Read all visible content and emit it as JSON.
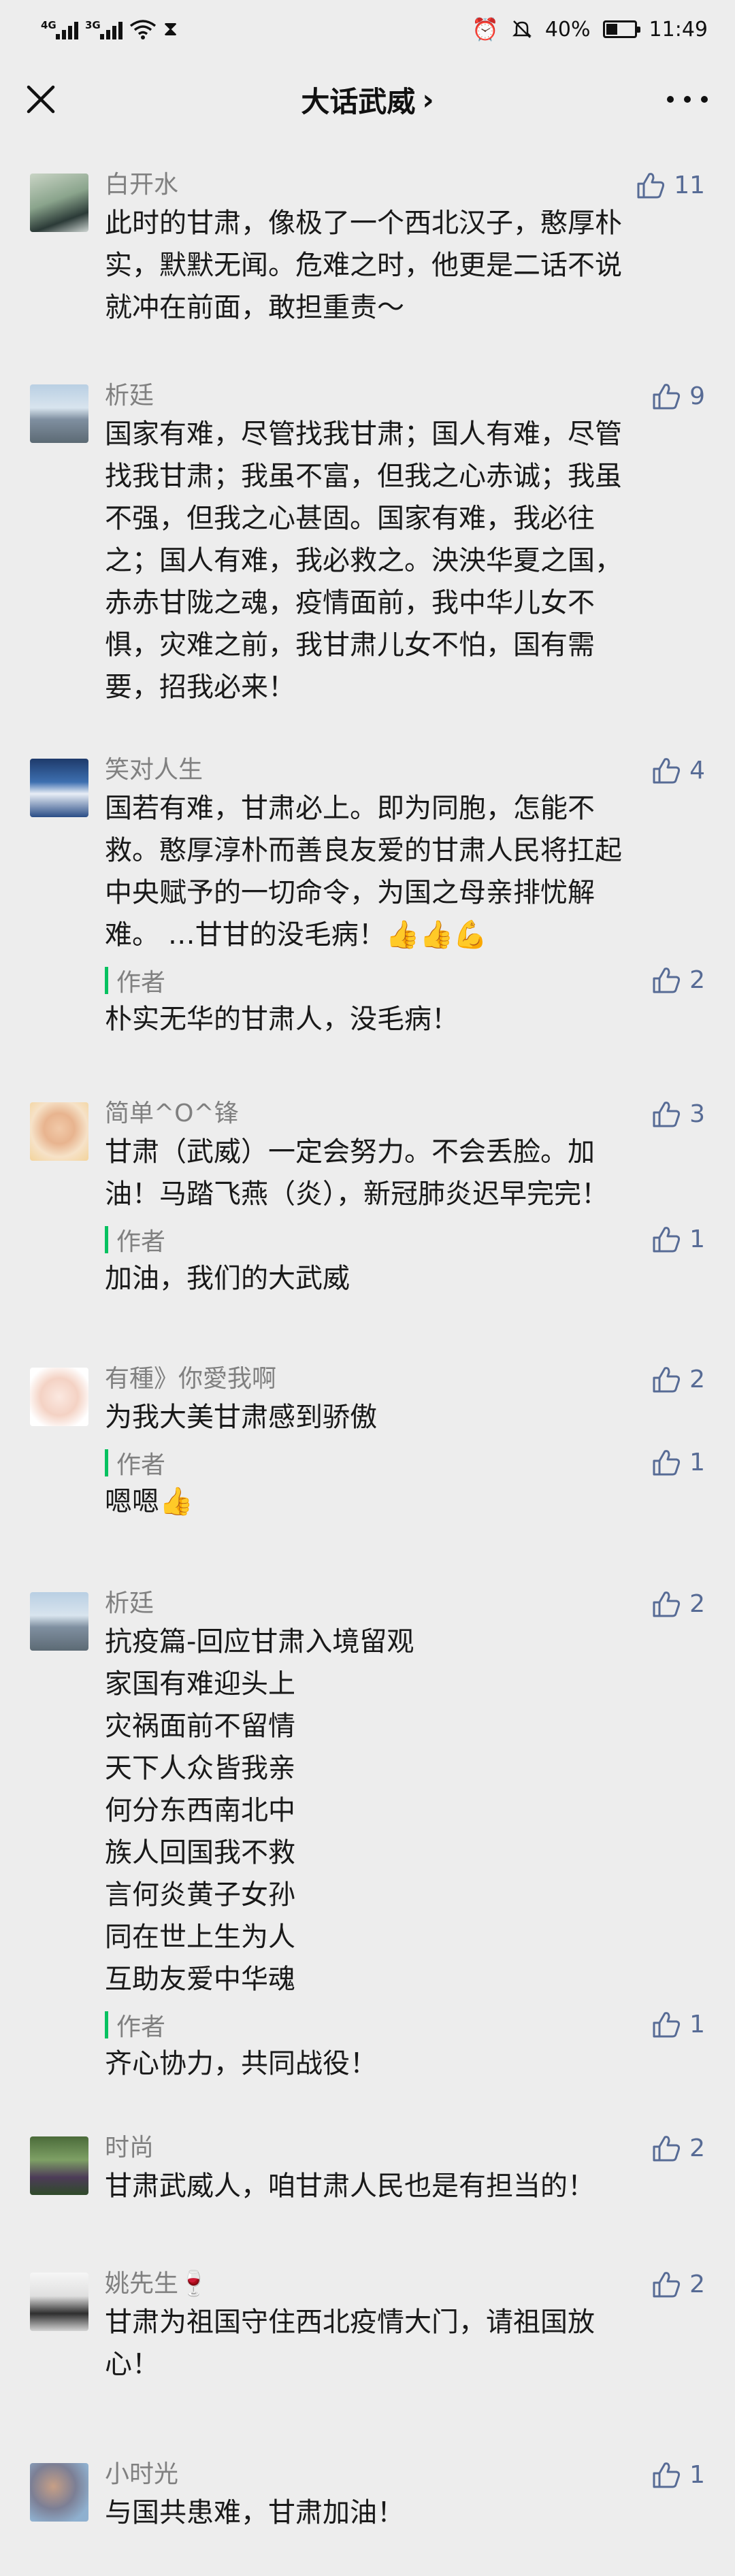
{
  "status_bar": {
    "sim1": "4G",
    "sim2": "3G",
    "battery_text": "40%",
    "battery_level": 0.4,
    "time": "11:49"
  },
  "nav": {
    "title": "大话武威",
    "chevron": "›",
    "close_icon": "close-icon",
    "more_icon": "more-icon"
  },
  "colors": {
    "background": "#ededed",
    "name_gray": "#808080",
    "like_blue": "#576b95",
    "author_green": "#07c160"
  },
  "comments": [
    {
      "name": "白开水",
      "likes": "11",
      "lines": [
        "此时的甘肃，像极了一个西北汉子，憨厚朴",
        "实，默默无闻。危难之时，他更是二话不说",
        "就冲在前面，敢担重责～"
      ]
    },
    {
      "name": "析廷",
      "likes": "9",
      "lines": [
        "国家有难，尽管找我甘肃；国人有难，尽管",
        "找我甘肃；我虽不富，但我之心赤诚；我虽",
        "不强，但我之心甚固。国家有难，我必往",
        "之；国人有难，我必救之。泱泱华夏之国，",
        "赤赤甘陇之魂，疫情面前，我中华儿女不",
        "惧，灾难之前，我甘肃儿女不怕，国有需",
        "要，招我必来！"
      ]
    },
    {
      "name": "笑对人生",
      "likes": "4",
      "lines": [
        "国若有难，甘肃必上。即为同胞，怎能不",
        "救。憨厚淳朴而善良友爱的甘肃人民将扛起",
        "中央赋予的一切命令，为国之母亲排忧解",
        "难。 …甘甘的没毛病！👍👍💪"
      ],
      "reply": {
        "label": "作者",
        "likes": "2",
        "text": "朴实无华的甘肃人，没毛病！"
      }
    },
    {
      "name": "简单^O^锋",
      "likes": "3",
      "lines": [
        "甘肃（武威）一定会努力。不会丢脸。加",
        "油！马踏飞燕（炎），新冠肺炎迟早完完！"
      ],
      "reply": {
        "label": "作者",
        "likes": "1",
        "text": "加油，我们的大武威"
      }
    },
    {
      "name": "有種》你愛我啊",
      "likes": "2",
      "lines": [
        "为我大美甘肃感到骄傲"
      ],
      "reply": {
        "label": "作者",
        "likes": "1",
        "text": "嗯嗯👍"
      }
    },
    {
      "name": "析廷",
      "likes": "2",
      "lines": [
        "抗疫篇-回应甘肃入境留观",
        "家国有难迎头上",
        "灾祸面前不留情",
        "天下人众皆我亲",
        "何分东西南北中",
        "族人回国我不救",
        "言何炎黄子女孙",
        "同在世上生为人",
        "互助友爱中华魂"
      ],
      "reply": {
        "label": "作者",
        "likes": "1",
        "text": "齐心协力，共同战役！"
      }
    },
    {
      "name": "时尚",
      "likes": "2",
      "lines": [
        "甘肃武威人，咱甘肃人民也是有担当的！"
      ]
    },
    {
      "name": "姚先生🍷",
      "likes": "2",
      "lines": [
        "甘肃为祖国守住西北疫情大门，请祖国放",
        "心！"
      ]
    },
    {
      "name": "小时光",
      "likes": "1",
      "lines": [
        "与国共患难，甘肃加油！"
      ]
    }
  ]
}
